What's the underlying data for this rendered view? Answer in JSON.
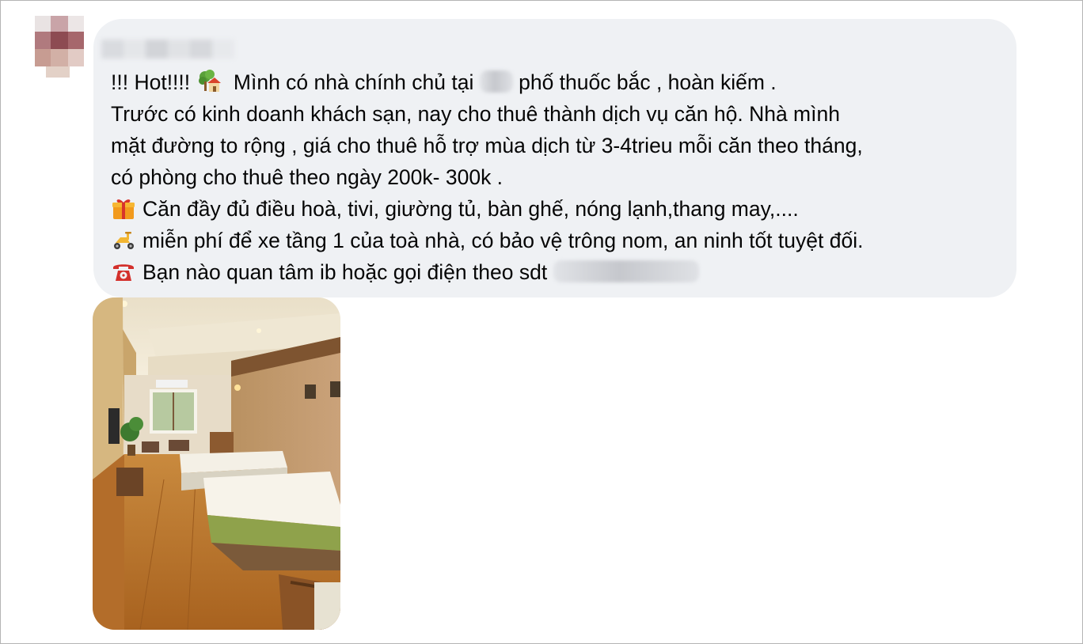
{
  "post": {
    "author_name": "",
    "lines": [
      {
        "pre": "!!! Hot!!!! ",
        "emoji": "tree-house-icon",
        "text_a": " Mình có nhà chính chủ tại ",
        "text_b": " phố thuốc bắc , hoàn kiếm ."
      },
      {
        "text": "Trước có kinh doanh khách sạn, nay cho thuê thành dịch vụ căn hộ. Nhà mình"
      },
      {
        "text": "mặt đường to rộng , giá cho thuê hỗ trợ mùa dịch từ 3-4trieu mỗi căn theo tháng,"
      },
      {
        "text": "có phòng cho thuê theo ngày 200k- 300k ."
      },
      {
        "emoji": "gift-icon",
        "text": "Căn đầy đủ điều hoà, tivi, giường tủ, bàn ghế, nóng lạnh,thang may,...."
      },
      {
        "emoji": "scooter-icon",
        "text": "miễn phí để xe tầng 1 của toà nhà, có bảo vệ trông nom, an ninh tốt tuyệt đối."
      },
      {
        "emoji": "telephone-icon",
        "text": "Bạn nào quan tâm ib hoặc gọi điện theo sdt "
      }
    ],
    "photo_description_icon": "hotel-room-photo"
  },
  "colors": {
    "bubble_bg": "#eff1f4",
    "text": "#050505",
    "frame_border": "#b4b4b4"
  }
}
